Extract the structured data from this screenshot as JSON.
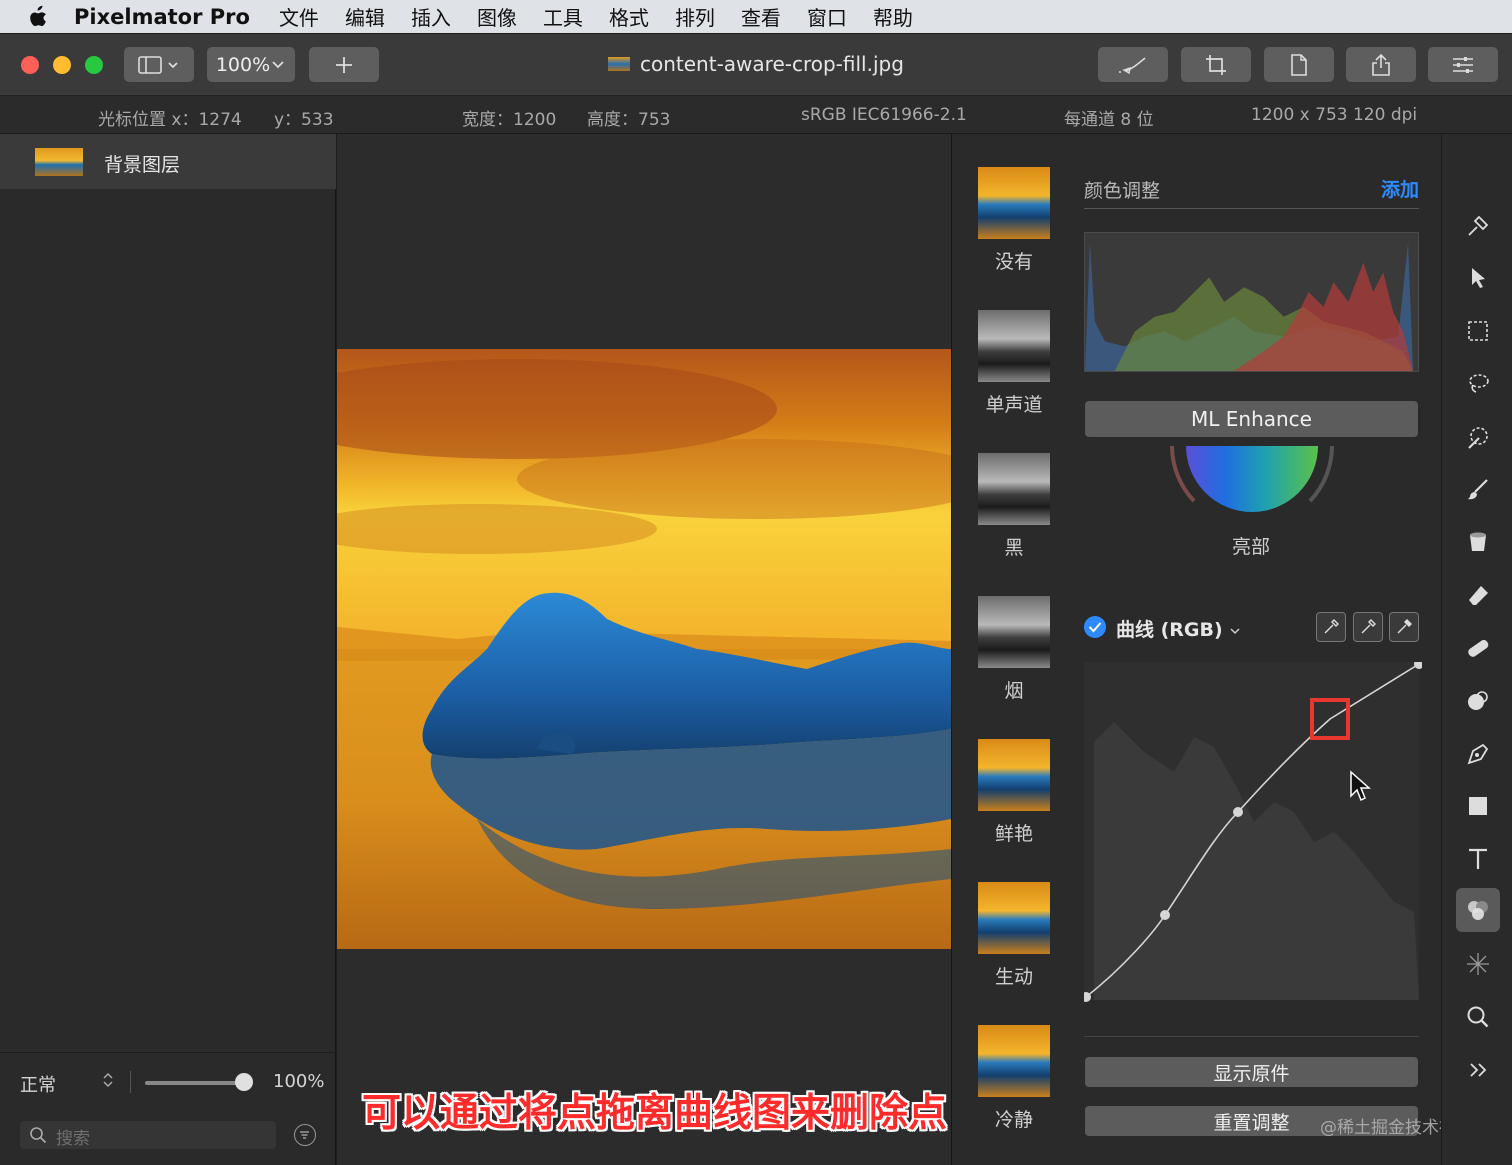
{
  "menubar": {
    "app_name": "Pixelmator Pro",
    "items": [
      "文件",
      "编辑",
      "插入",
      "图像",
      "工具",
      "格式",
      "排列",
      "查看",
      "窗口",
      "帮助"
    ]
  },
  "toolbar": {
    "zoom": "100%",
    "document_title": "content-aware-crop-fill.jpg"
  },
  "infobar": {
    "cursor_x": "光标位置 x：1274",
    "cursor_y": "y：533",
    "width": "宽度：1200",
    "height": "高度：753",
    "color_profile": "sRGB IEC61966-2.1",
    "bit_depth": "每通道 8 位",
    "dimensions": "1200 x 753 120 dpi"
  },
  "layers": {
    "items": [
      {
        "name": "背景图层"
      }
    ],
    "blend_mode": "正常",
    "opacity": "100%",
    "opacity_fraction": 1.0,
    "search_placeholder": "搜索"
  },
  "presets": [
    {
      "label": "没有",
      "style": "color"
    },
    {
      "label": "单声道",
      "style": "mono"
    },
    {
      "label": "黑",
      "style": "mono"
    },
    {
      "label": "烟",
      "style": "mono"
    },
    {
      "label": "鲜艳",
      "style": "color"
    },
    {
      "label": "生动",
      "style": "color"
    },
    {
      "label": "冷静",
      "style": "color"
    }
  ],
  "adjustments": {
    "title": "颜色调整",
    "add_label": "添加",
    "ml_enhance": "ML Enhance",
    "wheel_label": "亮部",
    "curves_title": "曲线 (RGB)",
    "curves_enabled": true,
    "show_original": "显示原件",
    "reset": "重置调整"
  },
  "caption": "可以通过将点拖离曲线图来删除点",
  "watermark": "@稀土掘金技术社区",
  "colors": {
    "accent": "#2d8bff",
    "caption": "#ff2a2a",
    "highlight_box": "#e8372f"
  },
  "tools": [
    "repair-icon",
    "arrow-select-icon",
    "rect-select-icon",
    "lasso-icon",
    "magic-wand-icon",
    "paint-brush-icon",
    "paint-bucket-icon",
    "eraser-icon",
    "bandage-icon",
    "clone-icon",
    "pen-icon",
    "shape-icon",
    "text-icon",
    "color-adjust-icon",
    "effects-icon",
    "zoom-icon",
    "more-icon"
  ]
}
